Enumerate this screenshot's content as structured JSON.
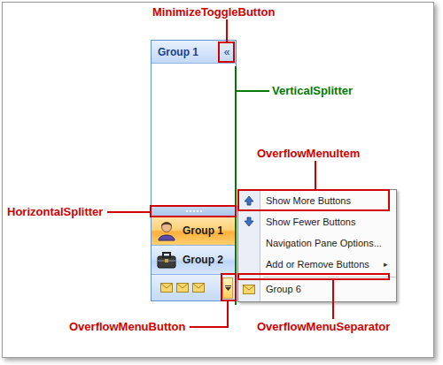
{
  "callouts": [
    {
      "label": "MinimizeToggleButton",
      "color": "#d00000"
    },
    {
      "label": "VerticalSplitter",
      "color": "#007a00"
    },
    {
      "label": "OverflowMenuItem",
      "color": "#d00000"
    },
    {
      "label": "HorizontalSplitter",
      "color": "#d00000"
    },
    {
      "label": "OverflowMenuButton",
      "color": "#d00000"
    },
    {
      "label": "OverflowMenuSeparator",
      "color": "#d00000"
    }
  ],
  "pane": {
    "header": {
      "title": "Group 1",
      "toggle": "«"
    },
    "groups": [
      {
        "label": "Group 1",
        "selected": true
      },
      {
        "label": "Group 2",
        "selected": false
      }
    ]
  },
  "menu": {
    "items": [
      {
        "label": "Show More Buttons",
        "kind": "more"
      },
      {
        "label": "Show Fewer Buttons",
        "kind": "fewer"
      },
      {
        "label": "Navigation Pane Options...",
        "kind": "plain"
      },
      {
        "label": "Add or Remove Buttons",
        "kind": "submenu",
        "arrow": "▸"
      },
      {
        "label": "",
        "kind": "separator"
      },
      {
        "label": "Group 6",
        "kind": "group"
      }
    ]
  }
}
